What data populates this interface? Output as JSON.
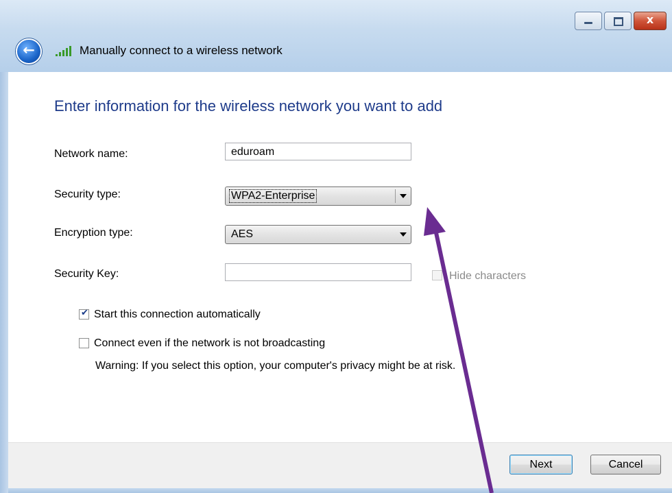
{
  "window": {
    "title": "Manually connect to a wireless network",
    "close_glyph": "x",
    "back_glyph": "←"
  },
  "form": {
    "heading": "Enter information for the wireless network you want to add",
    "network_name": {
      "label": "Network name:",
      "value": "eduroam"
    },
    "security_type": {
      "label": "Security type:",
      "value": "WPA2-Enterprise"
    },
    "encryption_type": {
      "label": "Encryption type:",
      "value": "AES"
    },
    "security_key": {
      "label": "Security Key:",
      "value": "",
      "hide_characters_label": "Hide characters",
      "hide_characters_checked": false
    },
    "start_automatically": {
      "label": "Start this connection automatically",
      "checked": true
    },
    "connect_not_broadcasting": {
      "label": "Connect even if the network is not broadcasting",
      "checked": false
    },
    "warning": "Warning: If you select this option, your computer's privacy might be at risk."
  },
  "footer": {
    "next_label": "Next",
    "cancel_label": "Cancel"
  },
  "icons": {
    "back": "back-arrow-icon",
    "signal": "wireless-signal-icon",
    "minimize": "minimize-icon",
    "maximize": "maximize-icon",
    "close": "close-icon",
    "checkmark": "checkmark-icon",
    "dropdown": "chevron-down-icon"
  },
  "colors": {
    "heading": "#1e3b8a",
    "annotation_arrow": "#6a2c91",
    "close_button": "#c8452a"
  }
}
